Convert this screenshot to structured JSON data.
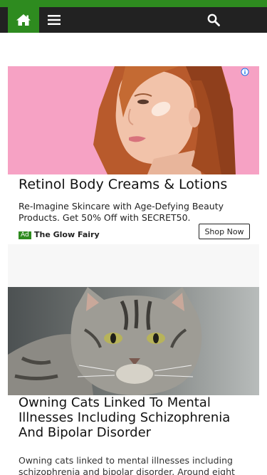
{
  "nav": {
    "home_icon": "home-icon",
    "menu_icon": "hamburger-menu-icon",
    "search_icon": "search-icon",
    "accent_color": "#2e8b1f",
    "bar_color": "#222222"
  },
  "ad": {
    "title": "Retinol Body Creams & Lotions",
    "description": "Re-Imagine Skincare with Age-Defying Beauty Products. Get 50% Off with SECRET50.",
    "badge": "Ad",
    "brand": "The Glow Fairy",
    "cta": "Shop Now",
    "image_alt": "Red-haired woman with cream on cheek"
  },
  "article": {
    "title": "Owning Cats Linked To Mental Illnesses Including Schizophrenia And Bipolar Disorder",
    "excerpt": "Owning cats linked to mental illnesses including schizophrenia and bipolar disorder. Around eight",
    "image_alt": "Tabby cat"
  }
}
